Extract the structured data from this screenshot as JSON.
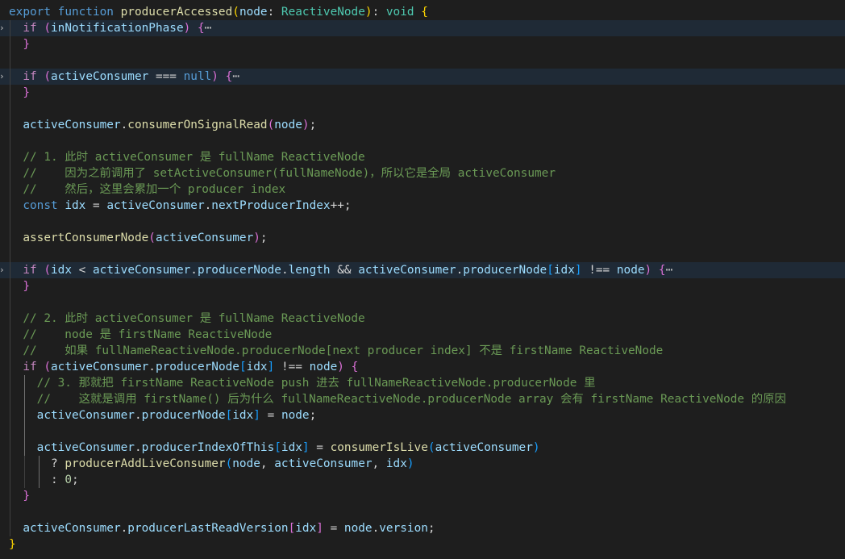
{
  "editor": {
    "lines": [
      {
        "indent": 0,
        "folded": false,
        "tokens": [
          [
            "kw",
            "export"
          ],
          [
            "pun",
            " "
          ],
          [
            "kw",
            "function"
          ],
          [
            "pun",
            " "
          ],
          [
            "fn",
            "producerAccessed"
          ],
          [
            "br1",
            "("
          ],
          [
            "var",
            "node"
          ],
          [
            "pun",
            ": "
          ],
          [
            "type",
            "ReactiveNode"
          ],
          [
            "br1",
            ")"
          ],
          [
            "pun",
            ": "
          ],
          [
            "type",
            "void"
          ],
          [
            "pun",
            " "
          ],
          [
            "br1",
            "{"
          ]
        ]
      },
      {
        "indent": 1,
        "folded": true,
        "tokens": [
          [
            "ctl",
            "if"
          ],
          [
            "pun",
            " "
          ],
          [
            "br2",
            "("
          ],
          [
            "var",
            "inNotificationPhase"
          ],
          [
            "br2",
            ")"
          ],
          [
            "pun",
            " "
          ],
          [
            "br2",
            "{"
          ],
          [
            "ell",
            "⋯"
          ]
        ]
      },
      {
        "indent": 1,
        "folded": false,
        "tokens": [
          [
            "br2",
            "}"
          ]
        ]
      },
      {
        "indent": 0,
        "folded": false,
        "tokens": []
      },
      {
        "indent": 1,
        "folded": true,
        "tokens": [
          [
            "ctl",
            "if"
          ],
          [
            "pun",
            " "
          ],
          [
            "br2",
            "("
          ],
          [
            "var",
            "activeConsumer"
          ],
          [
            "pun",
            " "
          ],
          [
            "op",
            "==="
          ],
          [
            "pun",
            " "
          ],
          [
            "kw",
            "null"
          ],
          [
            "br2",
            ")"
          ],
          [
            "pun",
            " "
          ],
          [
            "br2",
            "{"
          ],
          [
            "ell",
            "⋯"
          ]
        ]
      },
      {
        "indent": 1,
        "folded": false,
        "tokens": [
          [
            "br2",
            "}"
          ]
        ]
      },
      {
        "indent": 0,
        "folded": false,
        "tokens": []
      },
      {
        "indent": 1,
        "folded": false,
        "tokens": [
          [
            "var",
            "activeConsumer"
          ],
          [
            "pun",
            "."
          ],
          [
            "fn",
            "consumerOnSignalRead"
          ],
          [
            "br2",
            "("
          ],
          [
            "var",
            "node"
          ],
          [
            "br2",
            ")"
          ],
          [
            "pun",
            ";"
          ]
        ]
      },
      {
        "indent": 0,
        "folded": false,
        "tokens": []
      },
      {
        "indent": 1,
        "folded": false,
        "tokens": [
          [
            "cmt",
            "// 1. 此时 activeConsumer 是 fullName ReactiveNode"
          ]
        ]
      },
      {
        "indent": 1,
        "folded": false,
        "tokens": [
          [
            "cmt",
            "//    因为之前调用了 setActiveConsumer(fullNameNode)，所以它是全局 activeConsumer"
          ]
        ]
      },
      {
        "indent": 1,
        "folded": false,
        "tokens": [
          [
            "cmt",
            "//    然后，这里会累加一个 producer index"
          ]
        ]
      },
      {
        "indent": 1,
        "folded": false,
        "tokens": [
          [
            "kw",
            "const"
          ],
          [
            "pun",
            " "
          ],
          [
            "var",
            "idx"
          ],
          [
            "pun",
            " = "
          ],
          [
            "var",
            "activeConsumer"
          ],
          [
            "pun",
            "."
          ],
          [
            "var",
            "nextProducerIndex"
          ],
          [
            "op",
            "++"
          ],
          [
            "pun",
            ";"
          ]
        ]
      },
      {
        "indent": 0,
        "folded": false,
        "tokens": []
      },
      {
        "indent": 1,
        "folded": false,
        "tokens": [
          [
            "fn",
            "assertConsumerNode"
          ],
          [
            "br2",
            "("
          ],
          [
            "var",
            "activeConsumer"
          ],
          [
            "br2",
            ")"
          ],
          [
            "pun",
            ";"
          ]
        ]
      },
      {
        "indent": 0,
        "folded": false,
        "tokens": []
      },
      {
        "indent": 1,
        "folded": true,
        "tokens": [
          [
            "ctl",
            "if"
          ],
          [
            "pun",
            " "
          ],
          [
            "br2",
            "("
          ],
          [
            "var",
            "idx"
          ],
          [
            "pun",
            " < "
          ],
          [
            "var",
            "activeConsumer"
          ],
          [
            "pun",
            "."
          ],
          [
            "var",
            "producerNode"
          ],
          [
            "pun",
            "."
          ],
          [
            "var",
            "length"
          ],
          [
            "pun",
            " "
          ],
          [
            "op",
            "&&"
          ],
          [
            "pun",
            " "
          ],
          [
            "var",
            "activeConsumer"
          ],
          [
            "pun",
            "."
          ],
          [
            "var",
            "producerNode"
          ],
          [
            "br3",
            "["
          ],
          [
            "var",
            "idx"
          ],
          [
            "br3",
            "]"
          ],
          [
            "pun",
            " "
          ],
          [
            "op",
            "!=="
          ],
          [
            "pun",
            " "
          ],
          [
            "var",
            "node"
          ],
          [
            "br2",
            ")"
          ],
          [
            "pun",
            " "
          ],
          [
            "br2",
            "{"
          ],
          [
            "ell",
            "⋯"
          ]
        ]
      },
      {
        "indent": 1,
        "folded": false,
        "tokens": [
          [
            "br2",
            "}"
          ]
        ]
      },
      {
        "indent": 0,
        "folded": false,
        "tokens": []
      },
      {
        "indent": 1,
        "folded": false,
        "tokens": [
          [
            "cmt",
            "// 2. 此时 activeConsumer 是 fullName ReactiveNode"
          ]
        ]
      },
      {
        "indent": 1,
        "folded": false,
        "tokens": [
          [
            "cmt",
            "//    node 是 firstName ReactiveNode"
          ]
        ]
      },
      {
        "indent": 1,
        "folded": false,
        "tokens": [
          [
            "cmt",
            "//    如果 fullNameReactiveNode.producerNode[next producer index] 不是 firstName ReactiveNode"
          ]
        ]
      },
      {
        "indent": 1,
        "folded": false,
        "tokens": [
          [
            "ctl",
            "if"
          ],
          [
            "pun",
            " "
          ],
          [
            "br2",
            "("
          ],
          [
            "var",
            "activeConsumer"
          ],
          [
            "pun",
            "."
          ],
          [
            "var",
            "producerNode"
          ],
          [
            "br3",
            "["
          ],
          [
            "var",
            "idx"
          ],
          [
            "br3",
            "]"
          ],
          [
            "pun",
            " "
          ],
          [
            "op",
            "!=="
          ],
          [
            "pun",
            " "
          ],
          [
            "var",
            "node"
          ],
          [
            "br2",
            ")"
          ],
          [
            "pun",
            " "
          ],
          [
            "br2",
            "{"
          ]
        ]
      },
      {
        "indent": 2,
        "folded": false,
        "tokens": [
          [
            "cmt",
            "// 3. 那就把 firstName ReactiveNode push 进去 fullNameReactiveNode.producerNode 里"
          ]
        ]
      },
      {
        "indent": 2,
        "folded": false,
        "tokens": [
          [
            "cmt",
            "//    这就是调用 firstName() 后为什么 fullNameReactiveNode.producerNode array 会有 firstName ReactiveNode 的原因"
          ]
        ]
      },
      {
        "indent": 2,
        "folded": false,
        "tokens": [
          [
            "var",
            "activeConsumer"
          ],
          [
            "pun",
            "."
          ],
          [
            "var",
            "producerNode"
          ],
          [
            "br3",
            "["
          ],
          [
            "var",
            "idx"
          ],
          [
            "br3",
            "]"
          ],
          [
            "pun",
            " = "
          ],
          [
            "var",
            "node"
          ],
          [
            "pun",
            ";"
          ]
        ]
      },
      {
        "indent": 0,
        "folded": false,
        "tokens": []
      },
      {
        "indent": 2,
        "folded": false,
        "tokens": [
          [
            "var",
            "activeConsumer"
          ],
          [
            "pun",
            "."
          ],
          [
            "var",
            "producerIndexOfThis"
          ],
          [
            "br3",
            "["
          ],
          [
            "var",
            "idx"
          ],
          [
            "br3",
            "]"
          ],
          [
            "pun",
            " = "
          ],
          [
            "fn",
            "consumerIsLive"
          ],
          [
            "br3",
            "("
          ],
          [
            "var",
            "activeConsumer"
          ],
          [
            "br3",
            ")"
          ]
        ]
      },
      {
        "indent": 3,
        "folded": false,
        "tokens": [
          [
            "pun",
            "? "
          ],
          [
            "fn",
            "producerAddLiveConsumer"
          ],
          [
            "br3",
            "("
          ],
          [
            "var",
            "node"
          ],
          [
            "pun",
            ", "
          ],
          [
            "var",
            "activeConsumer"
          ],
          [
            "pun",
            ", "
          ],
          [
            "var",
            "idx"
          ],
          [
            "br3",
            ")"
          ]
        ]
      },
      {
        "indent": 3,
        "folded": false,
        "tokens": [
          [
            "pun",
            ": "
          ],
          [
            "num",
            "0"
          ],
          [
            "pun",
            ";"
          ]
        ]
      },
      {
        "indent": 1,
        "folded": false,
        "tokens": [
          [
            "br2",
            "}"
          ]
        ]
      },
      {
        "indent": 0,
        "folded": false,
        "tokens": []
      },
      {
        "indent": 1,
        "folded": false,
        "tokens": [
          [
            "var",
            "activeConsumer"
          ],
          [
            "pun",
            "."
          ],
          [
            "var",
            "producerLastReadVersion"
          ],
          [
            "br2",
            "["
          ],
          [
            "var",
            "idx"
          ],
          [
            "br2",
            "]"
          ],
          [
            "pun",
            " = "
          ],
          [
            "var",
            "node"
          ],
          [
            "pun",
            "."
          ],
          [
            "var",
            "version"
          ],
          [
            "pun",
            ";"
          ]
        ]
      },
      {
        "indent": 0,
        "folded": false,
        "tokens": [
          [
            "br1",
            "}"
          ]
        ]
      }
    ]
  }
}
